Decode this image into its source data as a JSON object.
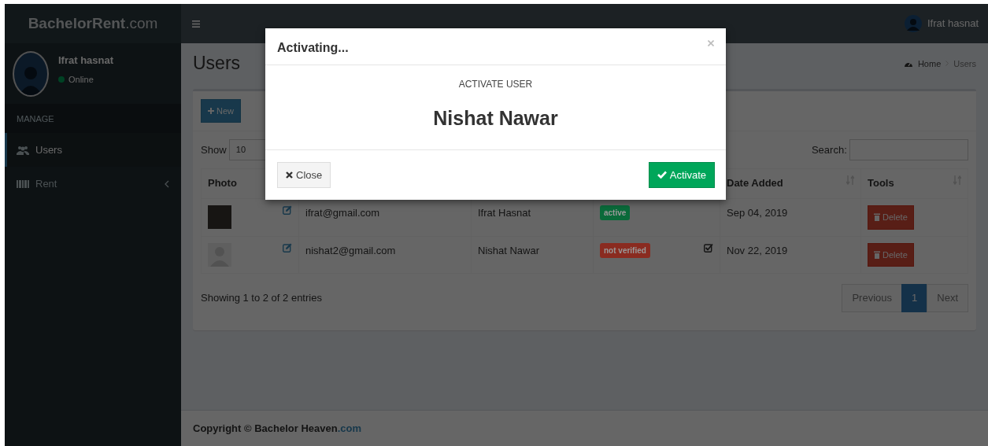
{
  "brand": {
    "bold": "BachelorRent",
    "rest": ".com"
  },
  "sidebar": {
    "user": {
      "name": "Ifrat hasnat",
      "status": "Online",
      "online": true
    },
    "header": "MANAGE",
    "items": [
      {
        "label": "Users",
        "kind": "users",
        "selected": true,
        "has_submenu": false
      },
      {
        "label": "Rent",
        "kind": "bars",
        "selected": false,
        "has_submenu": true
      }
    ]
  },
  "topbar": {
    "user_name": "Ifrat hasnat"
  },
  "page": {
    "title": "Users",
    "breadcrumb": [
      "Home",
      "Users"
    ]
  },
  "box": {
    "new_button": "New",
    "show_label": "Show",
    "show_value": "10",
    "search_label": "Search:",
    "table": {
      "columns": [
        {
          "label": "Photo"
        },
        {},
        {},
        {},
        {
          "label": "Date Added",
          "sortable": true
        },
        {
          "label": "Tools",
          "sortable": true
        }
      ],
      "rows": [
        {
          "kind": "photo",
          "email": "ifrat@gmail.com",
          "name": "Ifrat Hasnat",
          "status": {
            "text": "active",
            "color": "#0a6a3a"
          },
          "verify_icon": false,
          "date": "Sep 04, 2019",
          "delete": "Delete"
        },
        {
          "kind": "avatar",
          "email": "nishat2@gmail.com",
          "name": "Nishat Nawar",
          "status": {
            "text": "not verified",
            "color": "#8a2b20"
          },
          "verify_icon": true,
          "date": "Nov 22, 2019",
          "delete": "Delete"
        }
      ]
    },
    "info": "Showing 1 to 2 of 2 entries",
    "pagination": [
      {
        "label": "Previous",
        "selected": false
      },
      {
        "label": "1",
        "selected": true
      },
      {
        "label": "Next",
        "selected": false
      }
    ]
  },
  "footer": {
    "text": "Copyright © Bachelor Heaven",
    "link": ".com"
  },
  "dialog": {
    "title": "Activating...",
    "subtitle": "ACTIVATE USER",
    "name": "Nishat Nawar",
    "buttons": [
      {
        "label": "Close",
        "kind": "close"
      },
      {
        "label": "Activate",
        "kind": "activate"
      }
    ]
  }
}
